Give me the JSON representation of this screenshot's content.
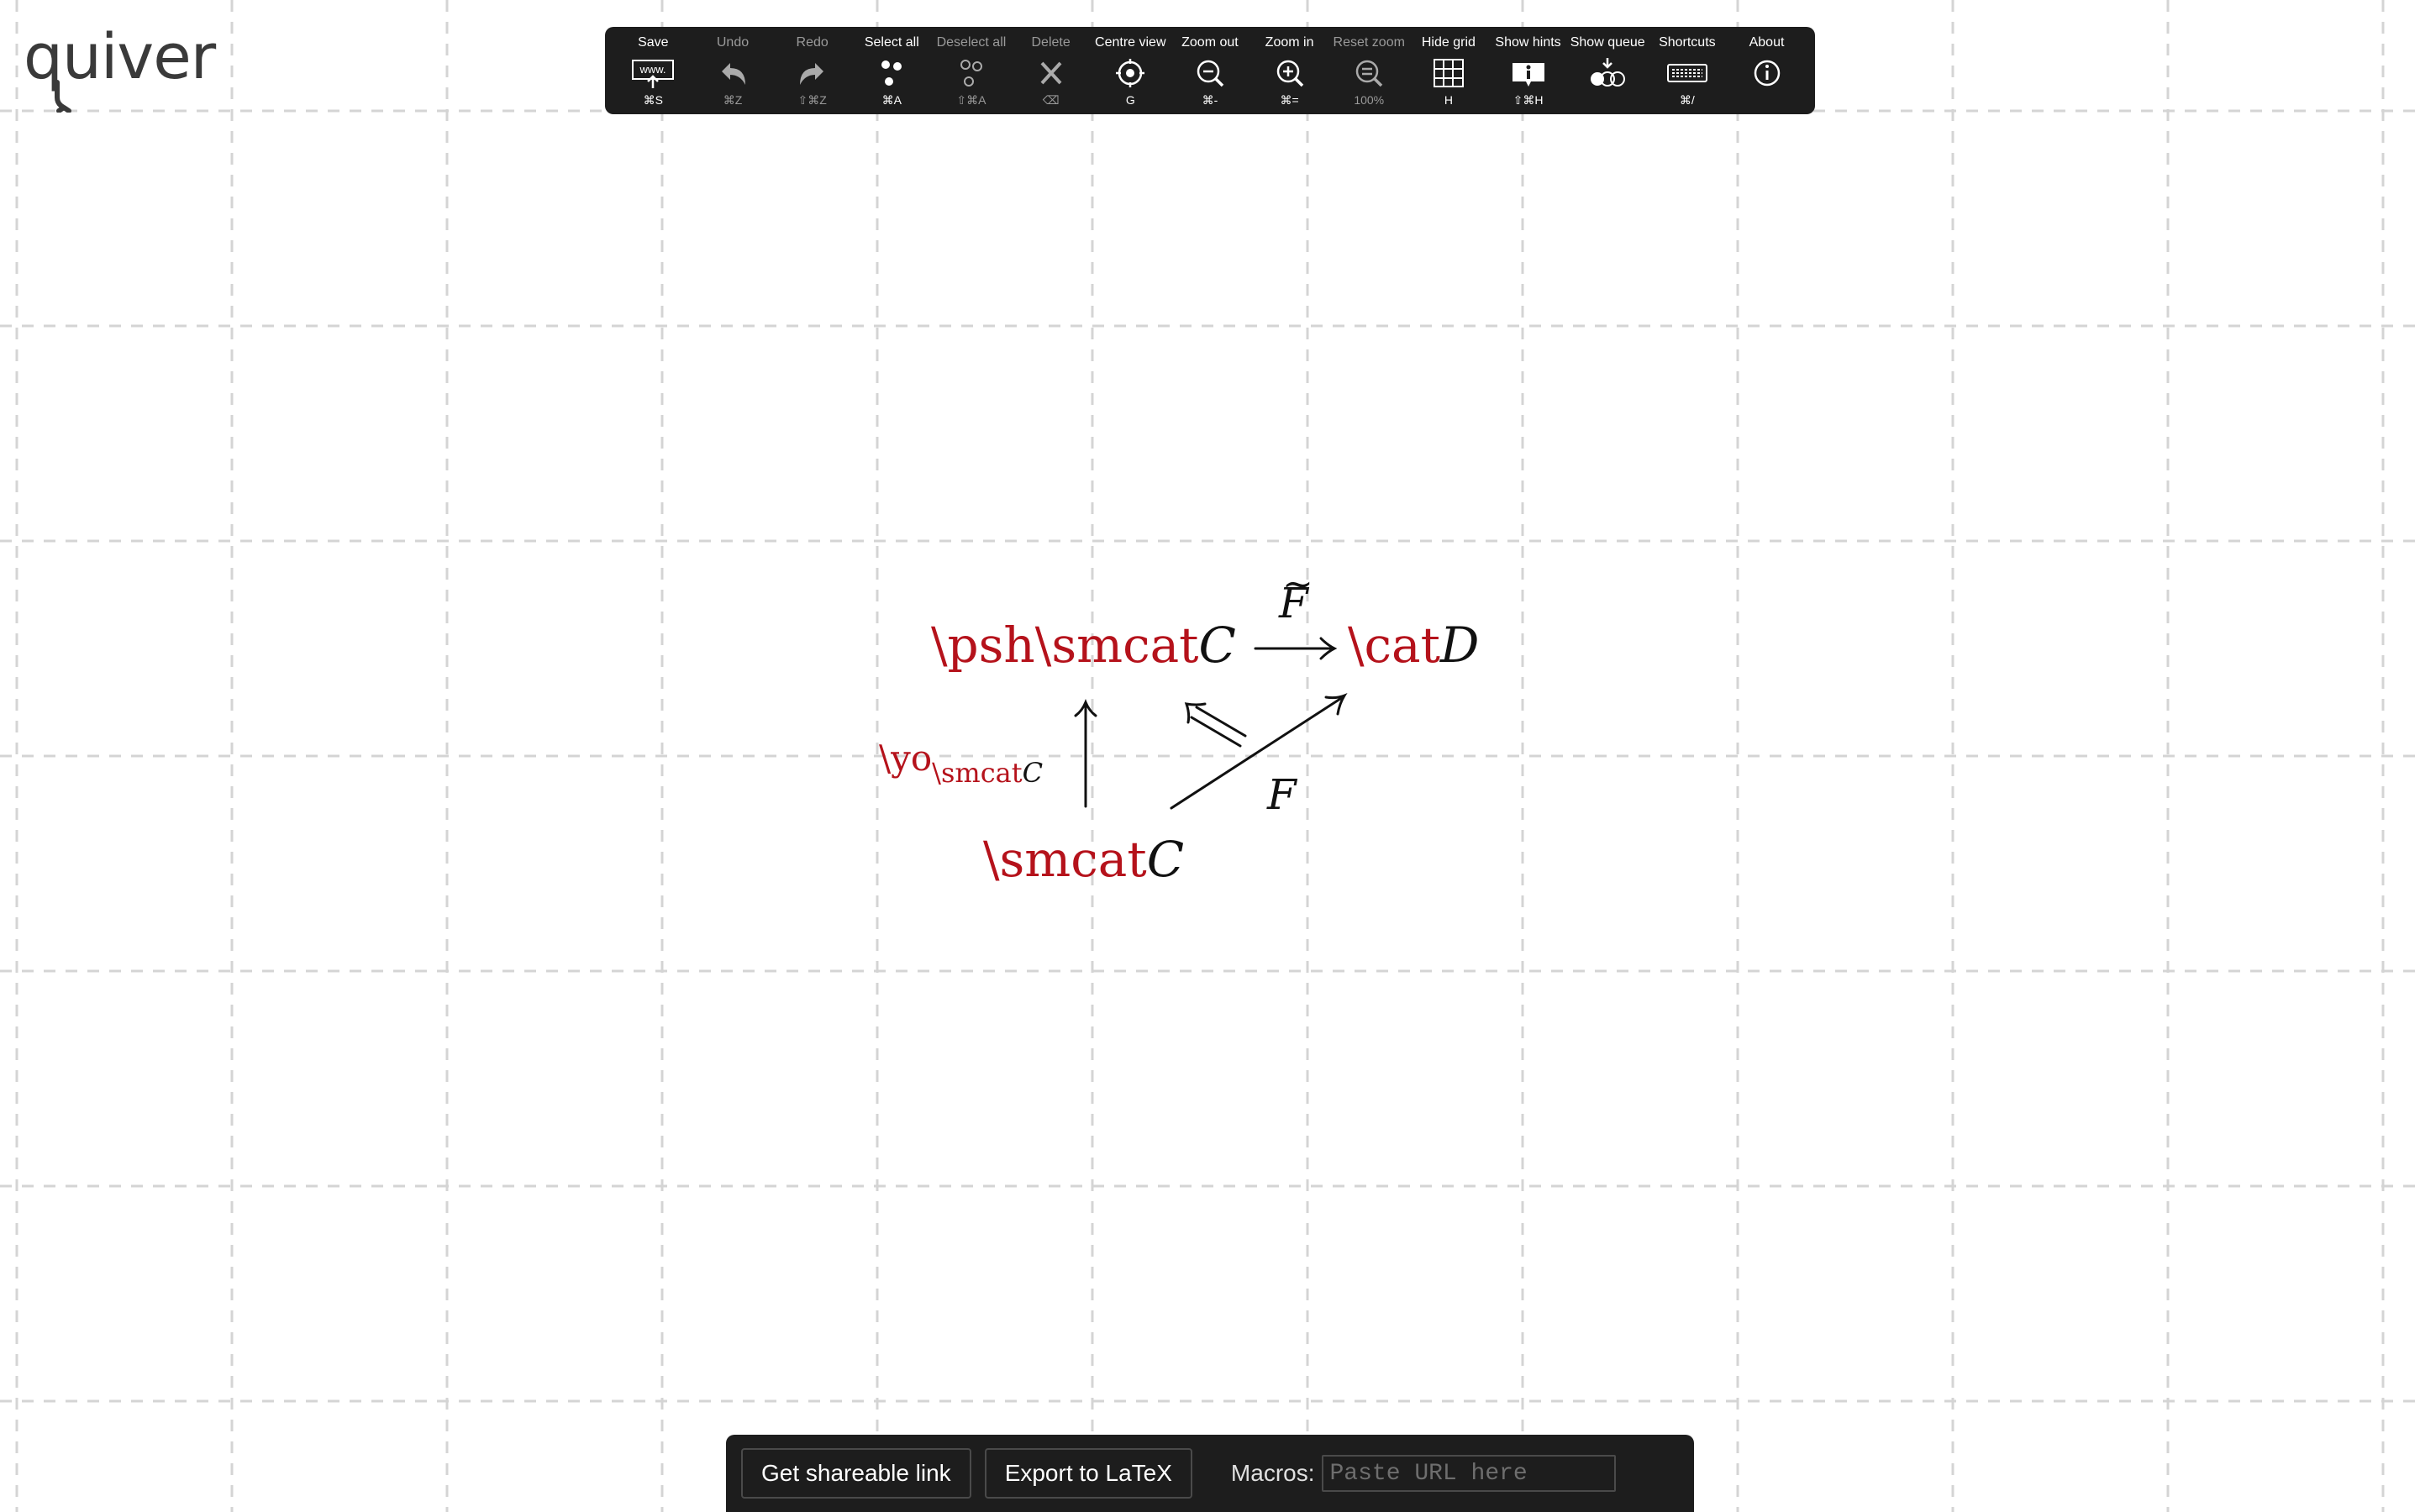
{
  "app": {
    "logo_text": "quiver"
  },
  "toolbar": {
    "items": [
      {
        "label": "Save",
        "shortcut": "⌘S",
        "icon": "save-url-icon"
      },
      {
        "label": "Undo",
        "shortcut": "⌘Z",
        "icon": "undo-icon"
      },
      {
        "label": "Redo",
        "shortcut": "⇧⌘Z",
        "icon": "redo-icon"
      },
      {
        "label": "Select all",
        "shortcut": "⌘A",
        "icon": "select-all-icon"
      },
      {
        "label": "Deselect all",
        "shortcut": "⇧⌘A",
        "icon": "deselect-all-icon"
      },
      {
        "label": "Delete",
        "shortcut": "⌫",
        "icon": "delete-icon"
      },
      {
        "label": "Centre view",
        "shortcut": "G",
        "icon": "centre-view-icon"
      },
      {
        "label": "Zoom out",
        "shortcut": "⌘-",
        "icon": "zoom-out-icon"
      },
      {
        "label": "Zoom in",
        "shortcut": "⌘=",
        "icon": "zoom-in-icon"
      },
      {
        "label": "Reset zoom",
        "shortcut": "100%",
        "icon": "reset-zoom-icon"
      },
      {
        "label": "Hide grid",
        "shortcut": "H",
        "icon": "grid-icon"
      },
      {
        "label": "Show hints",
        "shortcut": "⇧⌘H",
        "icon": "hints-icon"
      },
      {
        "label": "Show queue",
        "shortcut": "",
        "icon": "queue-icon"
      },
      {
        "label": "Shortcuts",
        "shortcut": "⌘/",
        "icon": "keyboard-icon"
      },
      {
        "label": "About",
        "shortcut": "",
        "icon": "info-icon"
      }
    ],
    "save_icon_text": "www."
  },
  "diagram": {
    "nodes": {
      "psh": {
        "macro": "\\psh\\smcat",
        "var": "C"
      },
      "cat": {
        "macro": "\\cat",
        "var": "D"
      },
      "smcat": {
        "macro": "\\smcat",
        "var": "C"
      }
    },
    "labels": {
      "top_arrow": "F",
      "top_arrow_accent": "~",
      "diag_arrow": "F",
      "yoneda_macro": "\\yo",
      "yoneda_sub_macro": "\\smcat",
      "yoneda_sub_var": "C"
    }
  },
  "export_panel": {
    "share_button": "Get shareable link",
    "latex_button": "Export to LaTeX",
    "macros_label": "Macros:",
    "macros_placeholder": "Paste URL here",
    "macros_value": ""
  },
  "colors": {
    "toolbar_bg": "#1d1d1d",
    "macro_red": "#b5121b",
    "grid_line": "#d4d4d4"
  }
}
